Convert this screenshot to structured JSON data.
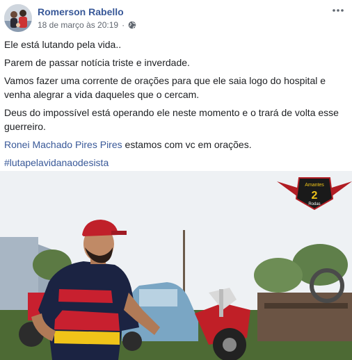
{
  "post": {
    "author": "Romerson Rabello",
    "timestamp": "18 de março às 20:19",
    "separator": "·",
    "privacy_icon": "globe-icon",
    "more_icon": "ellipsis-icon"
  },
  "content": {
    "paragraphs": [
      "Ele está lutando pela vida..",
      "Parem de passar notícia triste e inverdade.",
      "Vamos fazer uma corrente de orações para que ele saia logo do hospital e venha alegrar a vida daqueles que o cercam.",
      "Deus do impossível está operando ele neste momento e o trará de volta esse guerreiro."
    ],
    "mention": "Ronei Machado Pires Pires",
    "mention_suffix": " estamos com vc em orações.",
    "hashtag": "#lutapelavidanaodesista"
  },
  "photo": {
    "logo": {
      "top_text": "Amantes",
      "number": "2",
      "bottom_text": "Rodas"
    },
    "colors": {
      "sky": "#eef1f4",
      "jersey_red": "#c8202f",
      "jersey_navy": "#1b2342",
      "helmet_red": "#c0202a",
      "grass": "#4d6a34",
      "car_blue": "#7aa6c4"
    }
  }
}
